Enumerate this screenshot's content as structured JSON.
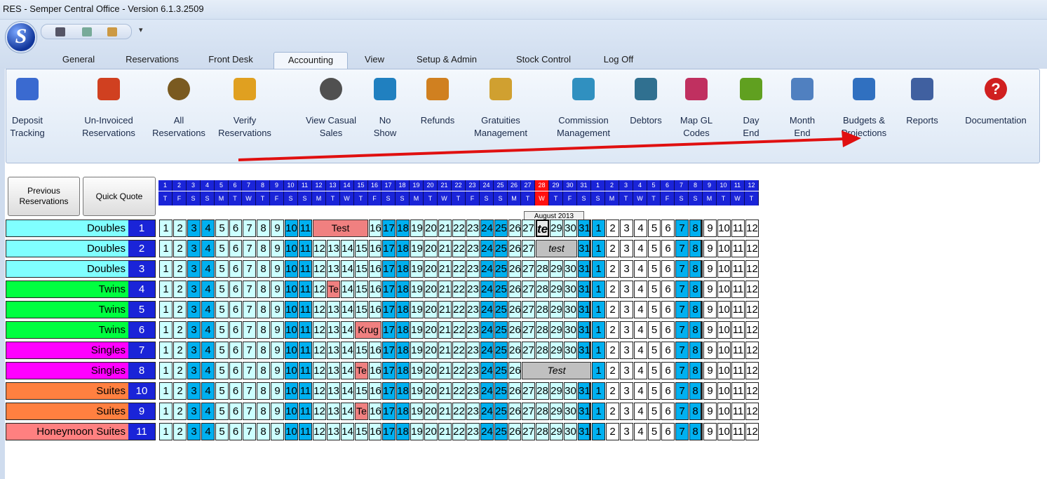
{
  "window": {
    "title": "RES - Semper Central Office - Version 6.1.3.2509"
  },
  "menu_tabs": [
    {
      "label": "General"
    },
    {
      "label": "Reservations"
    },
    {
      "label": "Front Desk"
    },
    {
      "label": "Accounting"
    },
    {
      "label": "View"
    },
    {
      "label": "Setup & Admin"
    },
    {
      "label": "Stock Control"
    },
    {
      "label": "Log Off"
    }
  ],
  "active_tab": "Accounting",
  "ribbon": [
    {
      "l1": "Deposit",
      "l2": "Tracking",
      "icon": "deposit-tracking-icon",
      "color": "#3a6ad0"
    },
    {
      "l1": "Un-Invoiced",
      "l2": "Reservations",
      "icon": "uninvoiced-icon",
      "color": "#d04020"
    },
    {
      "l1": "All",
      "l2": "Reservations",
      "icon": "all-reservations-icon",
      "color": "#7a5a20"
    },
    {
      "l1": "Verify",
      "l2": "Reservations",
      "icon": "verify-icon",
      "color": "#e0a020"
    },
    {
      "l1": "View Casual",
      "l2": "Sales",
      "icon": "casual-sales-icon",
      "color": "#505050"
    },
    {
      "l1": "No",
      "l2": "Show",
      "icon": "no-show-icon",
      "color": "#2080c0"
    },
    {
      "l1": "Refunds",
      "l2": "",
      "icon": "refunds-icon",
      "color": "#d08020"
    },
    {
      "l1": "Gratuities",
      "l2": "Management",
      "icon": "gratuities-icon",
      "color": "#d0a030"
    },
    {
      "l1": "Commission",
      "l2": "Management",
      "icon": "commission-icon",
      "color": "#3090c0"
    },
    {
      "l1": "Debtors",
      "l2": "",
      "icon": "debtors-icon",
      "color": "#307090"
    },
    {
      "l1": "Map GL",
      "l2": "Codes",
      "icon": "map-gl-icon",
      "color": "#c03060"
    },
    {
      "l1": "Day",
      "l2": "End",
      "icon": "day-end-icon",
      "color": "#60a020"
    },
    {
      "l1": "Month",
      "l2": "End",
      "icon": "month-end-icon",
      "color": "#5080c0"
    },
    {
      "l1": "Budgets &",
      "l2": "Projections",
      "icon": "budgets-icon",
      "color": "#3070c0"
    },
    {
      "l1": "Reports",
      "l2": "",
      "icon": "reports-icon",
      "color": "#4060a0"
    },
    {
      "l1": "Documentation",
      "l2": "",
      "icon": "documentation-icon",
      "color": "#d02020"
    }
  ],
  "buttons": {
    "previous": "Previous Reservations",
    "quick_quote": "Quick Quote"
  },
  "month_label": "August 2013",
  "days": [
    {
      "d": "1",
      "w": "T"
    },
    {
      "d": "2",
      "w": "F"
    },
    {
      "d": "3",
      "w": "S"
    },
    {
      "d": "4",
      "w": "S"
    },
    {
      "d": "5",
      "w": "M"
    },
    {
      "d": "6",
      "w": "T"
    },
    {
      "d": "7",
      "w": "W"
    },
    {
      "d": "8",
      "w": "T"
    },
    {
      "d": "9",
      "w": "F"
    },
    {
      "d": "10",
      "w": "S"
    },
    {
      "d": "11",
      "w": "S"
    },
    {
      "d": "12",
      "w": "M"
    },
    {
      "d": "13",
      "w": "T"
    },
    {
      "d": "14",
      "w": "W"
    },
    {
      "d": "15",
      "w": "T"
    },
    {
      "d": "16",
      "w": "F"
    },
    {
      "d": "17",
      "w": "S"
    },
    {
      "d": "18",
      "w": "S"
    },
    {
      "d": "19",
      "w": "M"
    },
    {
      "d": "20",
      "w": "T"
    },
    {
      "d": "21",
      "w": "W"
    },
    {
      "d": "22",
      "w": "T"
    },
    {
      "d": "23",
      "w": "F"
    },
    {
      "d": "24",
      "w": "S"
    },
    {
      "d": "25",
      "w": "S"
    },
    {
      "d": "26",
      "w": "M"
    },
    {
      "d": "27",
      "w": "T"
    },
    {
      "d": "28",
      "w": "W"
    },
    {
      "d": "29",
      "w": "T"
    },
    {
      "d": "30",
      "w": "F"
    },
    {
      "d": "31",
      "w": "S"
    },
    {
      "d": "1",
      "w": "S"
    },
    {
      "d": "2",
      "w": "M"
    },
    {
      "d": "3",
      "w": "T"
    },
    {
      "d": "4",
      "w": "W"
    },
    {
      "d": "5",
      "w": "T"
    },
    {
      "d": "6",
      "w": "F"
    },
    {
      "d": "7",
      "w": "S"
    },
    {
      "d": "8",
      "w": "S"
    },
    {
      "d": "9",
      "w": "M"
    },
    {
      "d": "10",
      "w": "T"
    },
    {
      "d": "11",
      "w": "W"
    },
    {
      "d": "12",
      "w": "T"
    }
  ],
  "today_index": 27,
  "colors": {
    "weekday": "#ccffff",
    "weekend": "#00b0f0",
    "sept": "#ffffff",
    "booking": "#f08080",
    "selected": "#c0c0c0",
    "header": "#1a24d8",
    "today": "#ff1010"
  },
  "rooms": [
    {
      "name": "Doubles",
      "no": "1",
      "color": "#80ffff",
      "bookings": [
        {
          "s": 11,
          "e": 14,
          "t": "Test",
          "k": "b"
        },
        {
          "s": 27,
          "e": 27,
          "t": "te",
          "k": "sel"
        }
      ]
    },
    {
      "name": "Doubles",
      "no": "2",
      "color": "#80ffff",
      "bookings": [
        {
          "s": 27,
          "e": 29,
          "t": "test",
          "k": "sel"
        }
      ]
    },
    {
      "name": "Doubles",
      "no": "3",
      "color": "#80ffff",
      "bookings": []
    },
    {
      "name": "Twins",
      "no": "4",
      "color": "#00ff40",
      "bookings": [
        {
          "s": 12,
          "e": 12,
          "t": "Te",
          "k": "b"
        }
      ]
    },
    {
      "name": "Twins",
      "no": "5",
      "color": "#00ff40",
      "bookings": []
    },
    {
      "name": "Twins",
      "no": "6",
      "color": "#00ff40",
      "bookings": [
        {
          "s": 14,
          "e": 15,
          "t": "Krug",
          "k": "b"
        }
      ]
    },
    {
      "name": "Singles",
      "no": "7",
      "color": "#ff00ff",
      "bookings": []
    },
    {
      "name": "Singles",
      "no": "8",
      "color": "#ff00ff",
      "bookings": [
        {
          "s": 14,
          "e": 14,
          "t": "Te",
          "k": "b"
        },
        {
          "s": 26,
          "e": 30,
          "t": "Test",
          "k": "sel"
        }
      ]
    },
    {
      "name": "Suites",
      "no": "10",
      "color": "#ff8040",
      "bookings": []
    },
    {
      "name": "Suites",
      "no": "9",
      "color": "#ff8040",
      "bookings": [
        {
          "s": 14,
          "e": 14,
          "t": "Te",
          "k": "b"
        }
      ]
    },
    {
      "name": "Honeymoon Suites",
      "no": "11",
      "color": "#ff8080",
      "bookings": []
    }
  ]
}
